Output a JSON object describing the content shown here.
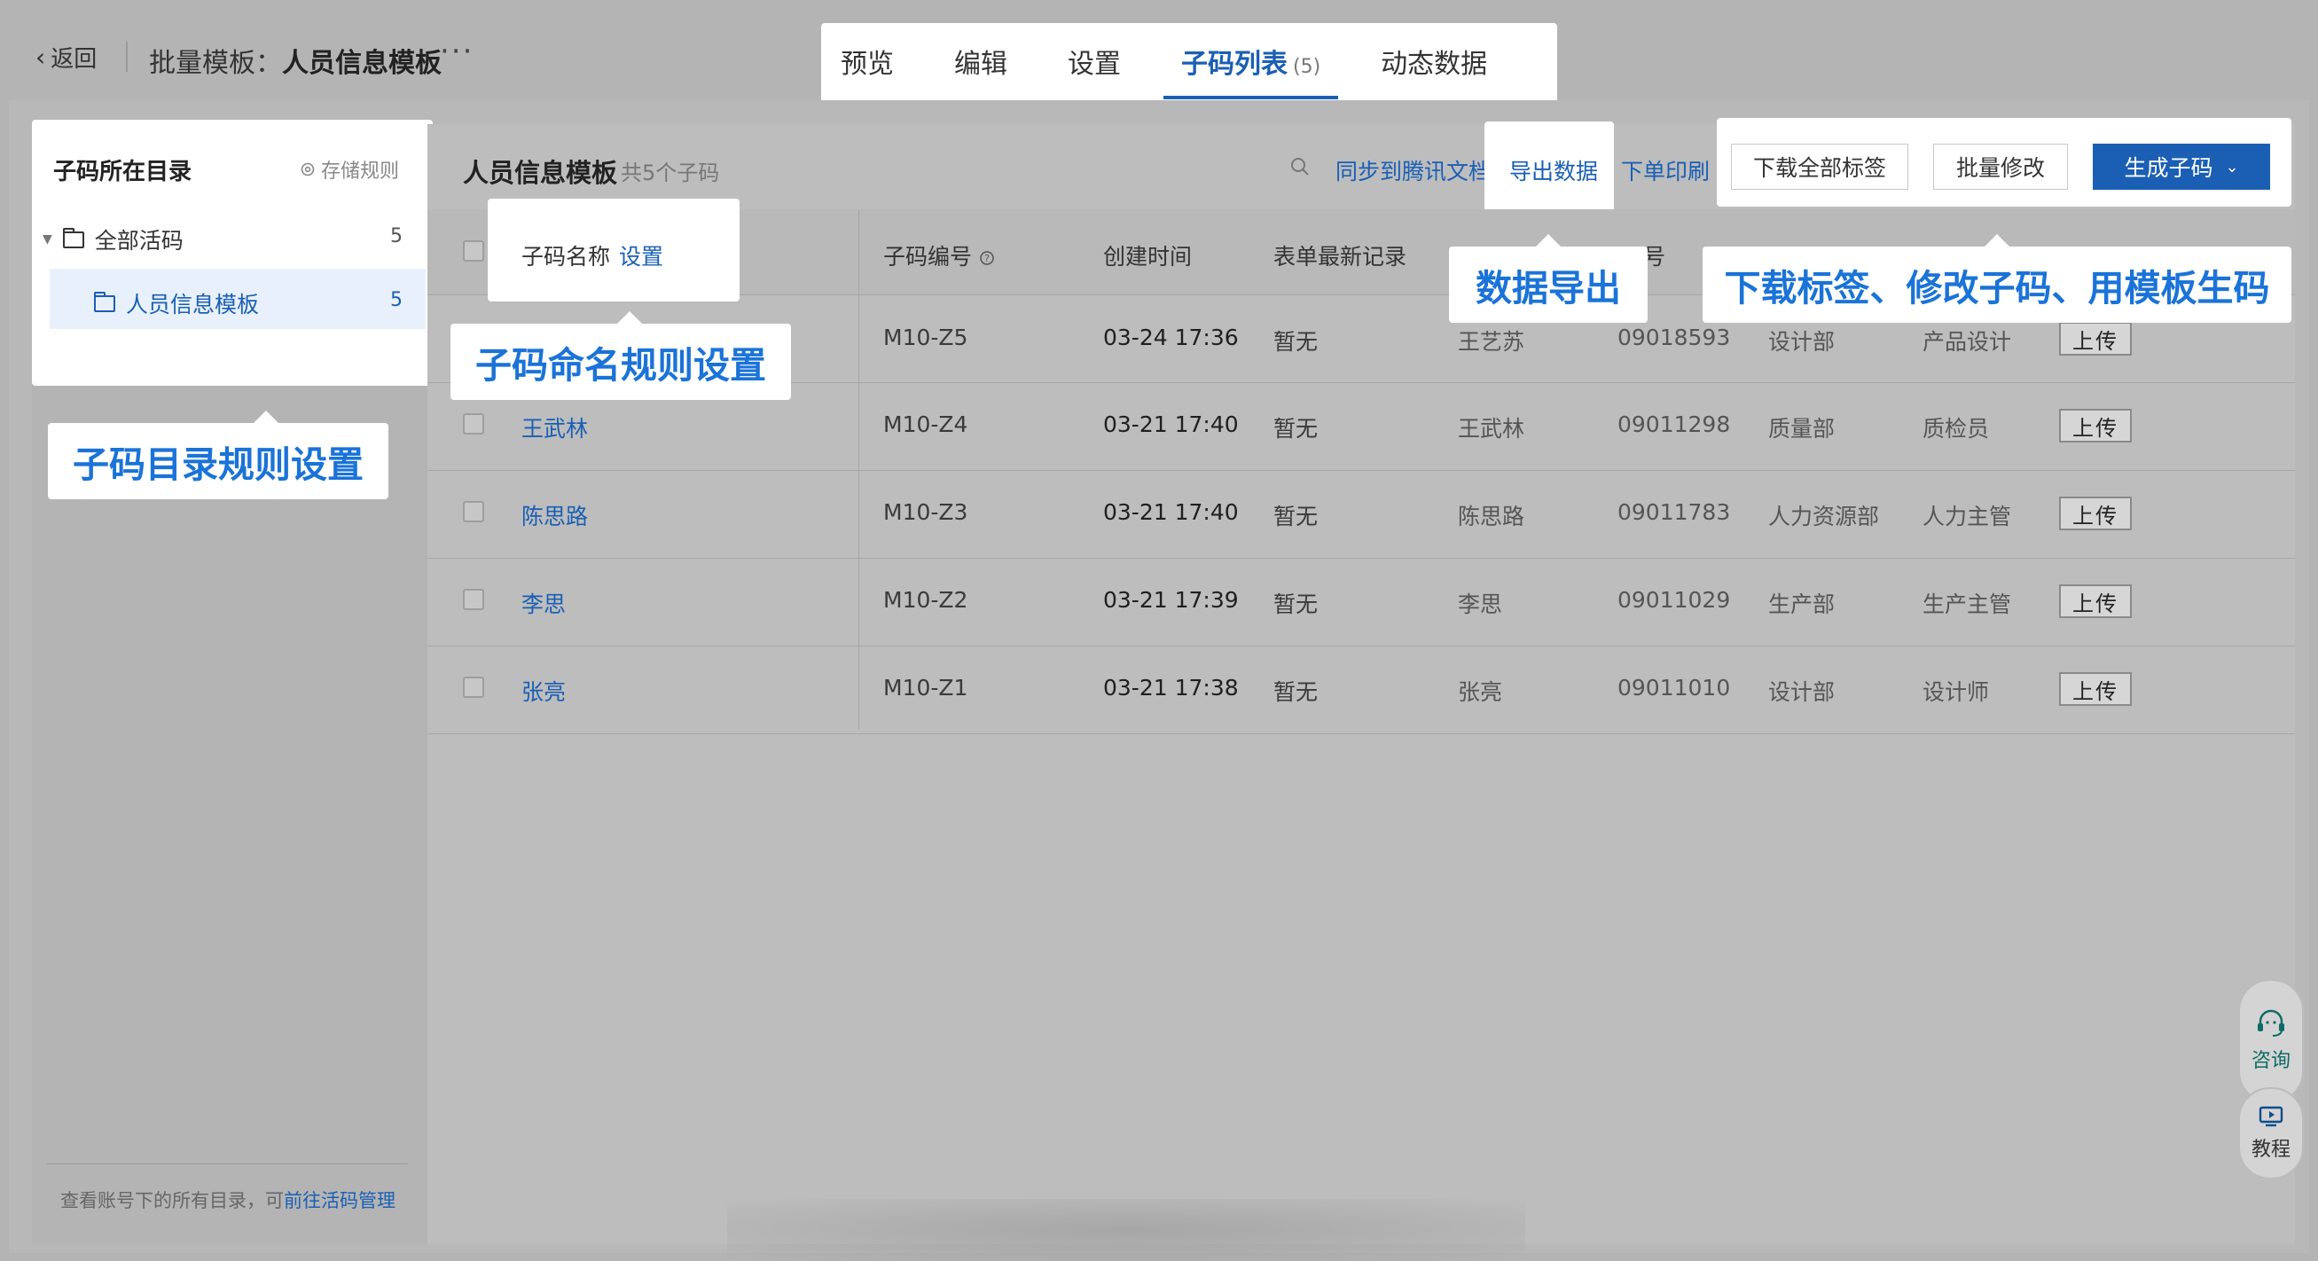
{
  "header": {
    "back_label": "返回",
    "title_prefix": "批量模板：",
    "title_name": "人员信息模板",
    "more_label": "···"
  },
  "tabs": [
    {
      "label": "预览"
    },
    {
      "label": "编辑"
    },
    {
      "label": "设置"
    },
    {
      "label": "子码列表",
      "count": "(5)",
      "active": true
    },
    {
      "label": "动态数据"
    }
  ],
  "sidebar": {
    "title": "子码所在目录",
    "rule_label": "存储规则",
    "tree": [
      {
        "label": "全部活码",
        "count": "5"
      },
      {
        "label": "人员信息模板",
        "count": "5",
        "selected": true
      }
    ],
    "footer_text": "查看账号下的所有目录，可",
    "footer_link": "前往活码管理"
  },
  "toolbar": {
    "title": "人员信息模板",
    "subtitle": "共5个子码",
    "sync_label": "同步到腾讯文档",
    "export_label": "导出数据",
    "order_label": "下单印刷",
    "download_all_label": "下载全部标签",
    "batch_edit_label": "批量修改",
    "generate_label": "生成子码"
  },
  "table": {
    "name_header": "子码名称",
    "name_header_link": "设置",
    "headers": [
      "子码编号",
      "创建时间",
      "表单最新记录",
      "工号"
    ],
    "rows": [
      {
        "code": "M10-Z5",
        "time": "03-24 17:36",
        "record": "暂无",
        "person": "王艺苏",
        "id": "09018593",
        "dept": "设计部",
        "role": "产品设计",
        "action": "上传"
      },
      {
        "name": "王武林",
        "code": "M10-Z4",
        "time": "03-21 17:40",
        "record": "暂无",
        "person": "王武林",
        "id": "09011298",
        "dept": "质量部",
        "role": "质检员",
        "action": "上传"
      },
      {
        "name": "陈思路",
        "code": "M10-Z3",
        "time": "03-21 17:40",
        "record": "暂无",
        "person": "陈思路",
        "id": "09011783",
        "dept": "人力资源部",
        "role": "人力主管",
        "action": "上传"
      },
      {
        "name": "李思",
        "code": "M10-Z2",
        "time": "03-21 17:39",
        "record": "暂无",
        "person": "李思",
        "id": "09011029",
        "dept": "生产部",
        "role": "生产主管",
        "action": "上传"
      },
      {
        "name": "张亮",
        "code": "M10-Z1",
        "time": "03-21 17:38",
        "record": "暂无",
        "person": "张亮",
        "id": "09011010",
        "dept": "设计部",
        "role": "设计师",
        "action": "上传"
      }
    ]
  },
  "callouts": {
    "dir_rule": "子码目录规则设置",
    "name_rule": "子码命名规则设置",
    "export": "数据导出",
    "actions": "下载标签、修改子码、用模板生码"
  },
  "floating": {
    "consult_label": "咨询",
    "tutorial_label": "教程"
  },
  "colors": {
    "accent": "#1a5fb4",
    "callout_text": "#1a73d8",
    "overlay": "#b4b4b4"
  }
}
